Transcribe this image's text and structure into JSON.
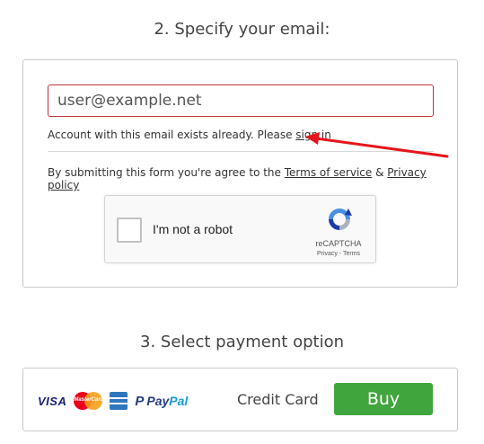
{
  "email_section": {
    "title": "2. Specify your email:",
    "email_value": "user@example.net",
    "exists_message": "Account with this email exists already. Please ",
    "sign_in_link": "sign in",
    "terms_prefix": "By submitting this form you're agree to the ",
    "terms_link": "Terms of service",
    "terms_and": " & ",
    "privacy_link": "Privacy policy",
    "captcha": {
      "label": "I'm not a robot",
      "brand": "reCAPTCHA",
      "privacy": "Privacy",
      "separator": " - ",
      "terms": "Terms"
    }
  },
  "payment_section": {
    "title": "3. Select payment option",
    "card_logos": {
      "visa": "VISA",
      "mastercard": "MasterCard",
      "paypal_1": "Pay",
      "paypal_2": "Pal",
      "paypal_icon": "P"
    },
    "method_label": "Credit Card",
    "buy_label": "Buy"
  },
  "annotation": {
    "arrow_color": "#e8141c"
  },
  "colors": {
    "error_border": "#c0353a",
    "buy_button": "#41a53d"
  }
}
